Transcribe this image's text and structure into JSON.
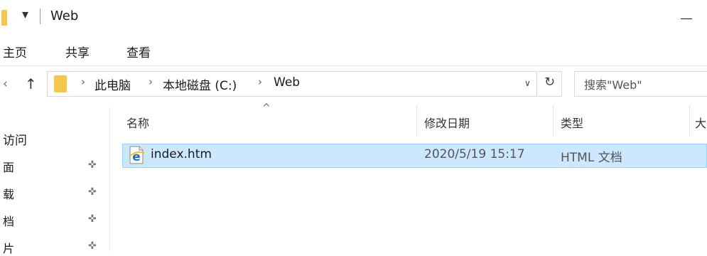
{
  "window": {
    "title": "Web",
    "qa_arrow": "▾",
    "minimize_icon": "minimize-icon"
  },
  "ribbon": {
    "tabs": [
      "主页",
      "共享",
      "查看"
    ]
  },
  "address_bar": {
    "back_icon": "‹",
    "up_icon": "↑",
    "separator": "›",
    "crumbs": [
      "此电脑",
      "本地磁盘 (C:)",
      "Web"
    ],
    "dropdown_icon": "∨",
    "refresh_icon": "↻"
  },
  "search": {
    "placeholder": "搜索\"Web\""
  },
  "sidebar": {
    "section": "访问",
    "items": [
      "面",
      "载",
      "档",
      "片"
    ],
    "pin_icon": "📌"
  },
  "columns": {
    "sort_indicator": "^",
    "name": "名称",
    "modified": "修改日期",
    "type": "类型",
    "size": "大"
  },
  "files": [
    {
      "name": "index.htm",
      "modified": "2020/5/19 15:17",
      "type": "HTML 文档",
      "icon": "ie-html-icon"
    }
  ],
  "colors": {
    "selection_bg": "#cce8ff",
    "selection_border": "#99d1ff",
    "folder": "#f3c74a",
    "ie_blue": "#1d6ed8"
  }
}
